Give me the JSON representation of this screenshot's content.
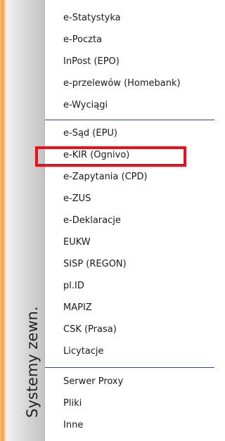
{
  "sidebar": {
    "label": "Systemy zewn."
  },
  "menu": {
    "group1": [
      "e-Statystyka",
      "e-Poczta",
      "InPost (EPO)",
      "e-przelewów (Homebank)",
      "e-Wyciągi"
    ],
    "group2": [
      "e-Sąd (EPU)",
      "e-KIR (Ognivo)",
      "e-Zapytania (CPD)",
      "e-ZUS",
      "e-Deklaracje",
      "EUKW",
      "SISP (REGON)",
      "pl.ID",
      "MAPIZ",
      "CSK (Prasa)",
      "Licytacje"
    ],
    "group3": [
      "Serwer Proxy",
      "Pliki",
      "Inne"
    ]
  },
  "highlight": {
    "target": "e-KIR (Ognivo)",
    "color": "#e8101c"
  }
}
